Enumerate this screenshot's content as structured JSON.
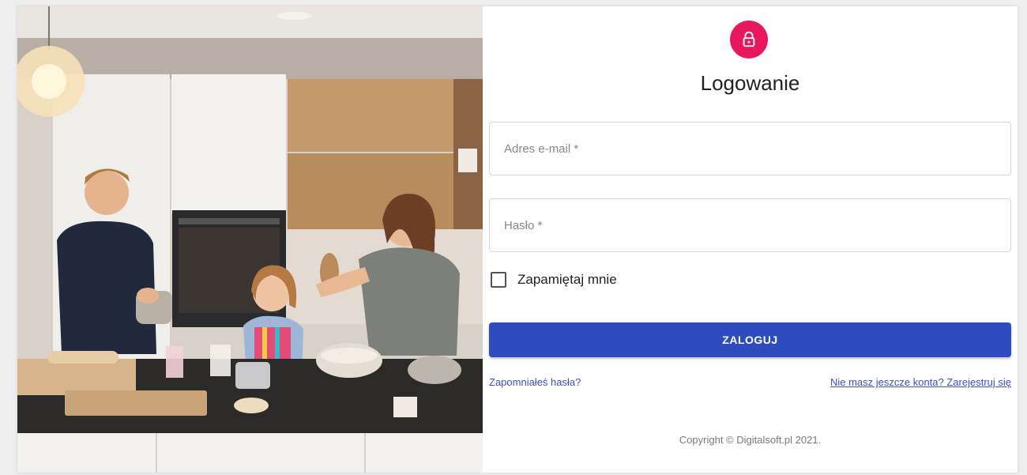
{
  "login": {
    "title": "Logowanie",
    "email_placeholder": "Adres e-mail *",
    "password_placeholder": "Hasło *",
    "remember_label": "Zapamiętaj mnie",
    "submit_label": "ZALOGUJ",
    "forgot_link": "Zapomniałeś hasła?",
    "register_link": "Nie masz jeszcze konta? Zarejestruj się",
    "copyright": "Copyright © Digitalsoft.pl 2021."
  },
  "icons": {
    "avatar": "lock-icon",
    "remember": "checkbox-unchecked"
  },
  "colors": {
    "accent_pink": "#e8175d",
    "primary_blue": "#2e4cc0",
    "link_blue": "#3b4fc9"
  }
}
